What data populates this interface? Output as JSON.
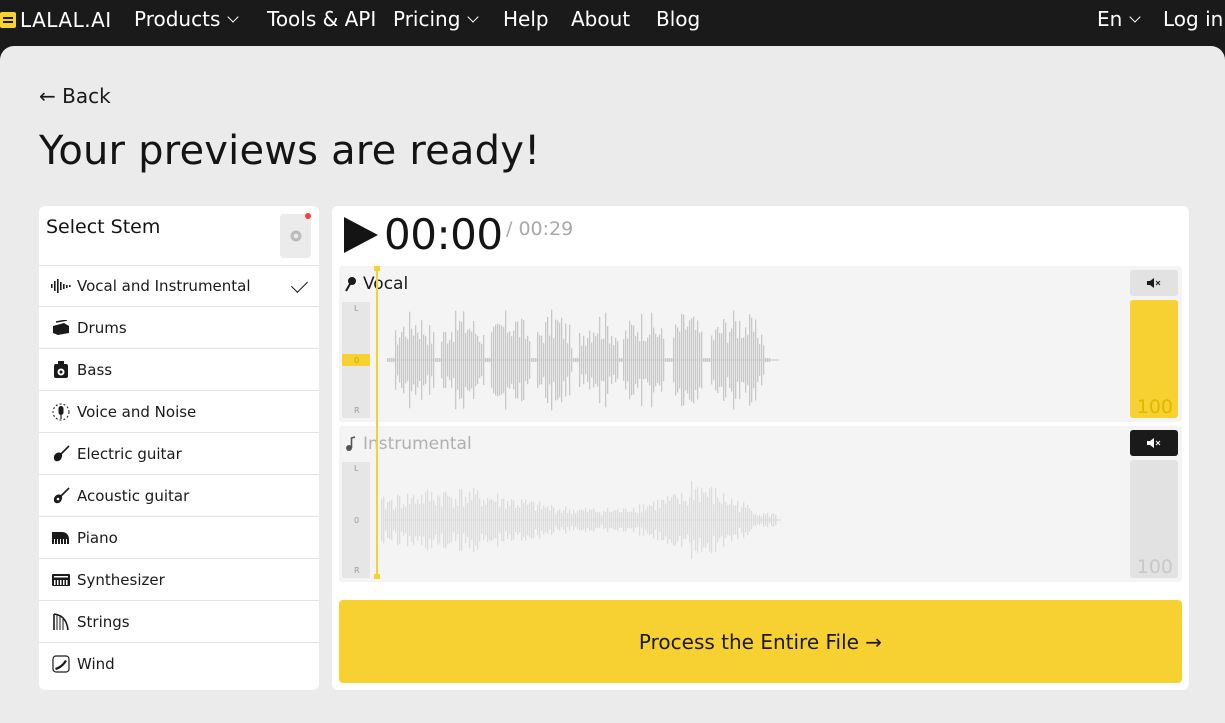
{
  "nav": {
    "logo": "LALAL.AI",
    "items": [
      {
        "label": "Products",
        "dropdown": true
      },
      {
        "label": "Tools & API",
        "dropdown": false
      },
      {
        "label": "Pricing",
        "dropdown": true
      },
      {
        "label": "Help",
        "dropdown": false
      },
      {
        "label": "About",
        "dropdown": false
      },
      {
        "label": "Blog",
        "dropdown": false
      }
    ],
    "language": "En",
    "login": "Log in"
  },
  "page": {
    "back": "← Back",
    "title": "Your previews are ready!"
  },
  "stems": {
    "title": "Select Stem",
    "items": [
      {
        "label": "Vocal and Instrumental",
        "icon": "waveform-icon",
        "selected": true
      },
      {
        "label": "Drums",
        "icon": "drum-icon"
      },
      {
        "label": "Bass",
        "icon": "bass-amp-icon"
      },
      {
        "label": "Voice and Noise",
        "icon": "voice-noise-icon"
      },
      {
        "label": "Electric guitar",
        "icon": "electric-guitar-icon"
      },
      {
        "label": "Acoustic guitar",
        "icon": "acoustic-guitar-icon"
      },
      {
        "label": "Piano",
        "icon": "piano-icon"
      },
      {
        "label": "Synthesizer",
        "icon": "synthesizer-icon"
      },
      {
        "label": "Strings",
        "icon": "strings-icon"
      },
      {
        "label": "Wind",
        "icon": "wind-icon"
      }
    ]
  },
  "player": {
    "current_time": "00:00",
    "total_time": "/ 00:29",
    "tracks": [
      {
        "name": "Vocal",
        "volume": "100",
        "muted": false,
        "active": true,
        "meter": [
          "L",
          "0",
          "R"
        ]
      },
      {
        "name": "Instrumental",
        "volume": "100",
        "muted": true,
        "active": false,
        "meter": [
          "L",
          "0",
          "R"
        ]
      }
    ],
    "process_button": "Process the Entire File →"
  },
  "colors": {
    "accent": "#f7d131",
    "nav_bg": "#1a1a1a",
    "page_bg": "#ebebeb",
    "wave": "#c8c8c8",
    "wave_dim": "#dcdcdc"
  }
}
